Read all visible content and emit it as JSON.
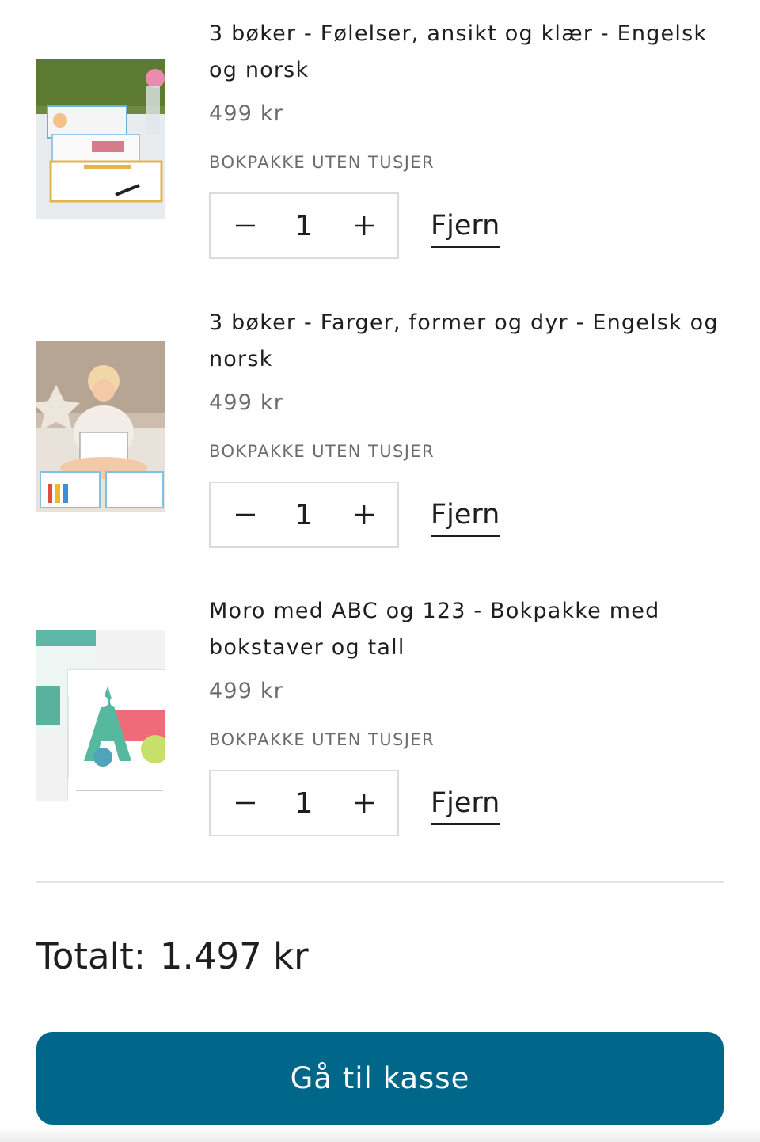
{
  "cart": {
    "items": [
      {
        "title": "3 bøker - Følelser, ansikt og klær - Engelsk og norsk",
        "price": "499 kr",
        "variant": "BOKPAKKE UTEN TUSJER",
        "quantity": "1",
        "remove_label": "Fjern",
        "image_alt": "Book bundle on garden table"
      },
      {
        "title": "3 bøker - Farger, former og dyr - Engelsk og norsk",
        "price": "499 kr",
        "variant": "BOKPAKKE UTEN TUSJER",
        "quantity": "1",
        "remove_label": "Fjern",
        "image_alt": "Child reading book"
      },
      {
        "title": "Moro med ABC og 123 - Bokpakke med bokstaver og tall",
        "price": "499 kr",
        "variant": "BOKPAKKE UTEN TUSJER",
        "quantity": "1",
        "remove_label": "Fjern",
        "image_alt": "Moro med bokstaver book"
      }
    ],
    "total_label": "Totalt:",
    "total_value": "1.497 kr",
    "checkout_label": "Gå til kasse"
  },
  "icons": {
    "decrease": "minus-icon",
    "increase": "plus-icon"
  },
  "colors": {
    "checkout_button": "#00668a",
    "price_text": "#6b6b6b",
    "border": "#dcdcdc"
  }
}
